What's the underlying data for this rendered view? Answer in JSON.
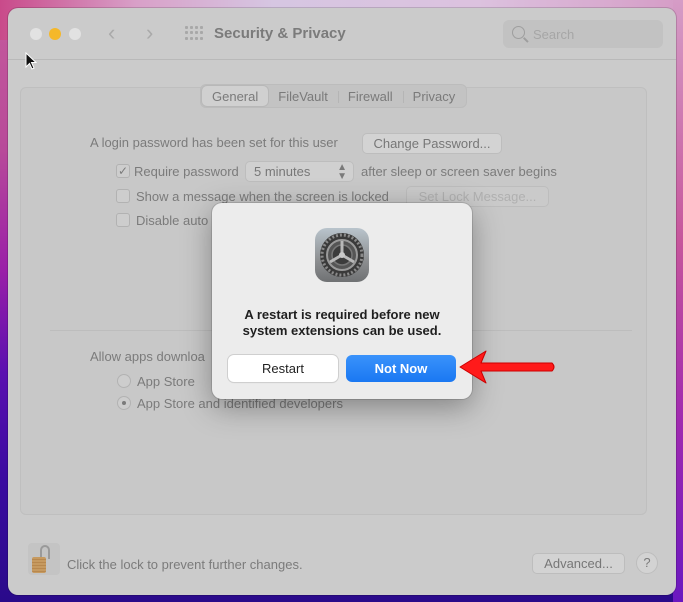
{
  "window": {
    "title": "Security & Privacy",
    "search_placeholder": "Search"
  },
  "tabs": [
    {
      "label": "General",
      "active": true
    },
    {
      "label": "FileVault",
      "active": false
    },
    {
      "label": "Firewall",
      "active": false
    },
    {
      "label": "Privacy",
      "active": false
    }
  ],
  "general": {
    "login_password_text": "A login password has been set for this user",
    "change_password_label": "Change Password...",
    "require_password_label": "Require password",
    "require_password_checked": true,
    "require_password_delay": "5 minutes",
    "require_password_suffix": "after sleep or screen saver begins",
    "show_message_label": "Show a message when the screen is locked",
    "show_message_checked": false,
    "set_lock_message_label": "Set Lock Message...",
    "disable_auto_label": "Disable auto",
    "disable_auto_checked": false,
    "allow_apps_label": "Allow apps downloa",
    "radio_app_store": "App Store",
    "radio_identified": "App Store and identified developers",
    "selected_radio": "App Store and identified developers"
  },
  "footer": {
    "lock_text": "Click the lock to prevent further changes.",
    "advanced_label": "Advanced...",
    "help_label": "?"
  },
  "dialog": {
    "message_line1": "A restart is required before new",
    "message_line2": "system extensions can be used.",
    "restart_label": "Restart",
    "not_now_label": "Not Now"
  },
  "annotation": {
    "arrow_color": "#ff1a1a",
    "points_to": "Not Now"
  },
  "colors": {
    "accent": "#1a78f2",
    "minimize": "#f5b82a"
  }
}
